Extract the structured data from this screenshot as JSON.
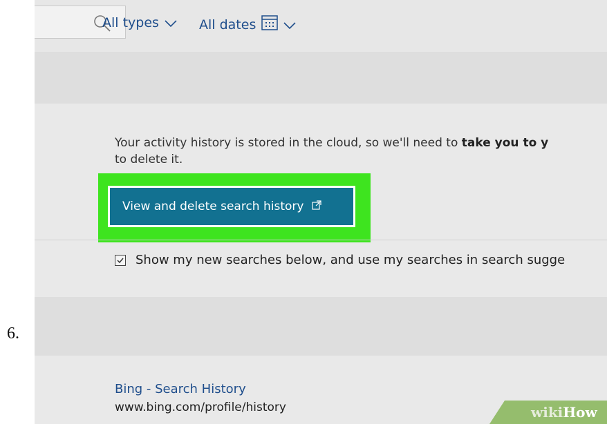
{
  "step_number": "6.",
  "toolbar": {
    "filter_types": "All types",
    "filter_dates": "All dates"
  },
  "notice": {
    "text_start": "Your activity history is stored in the cloud, so we'll need to ",
    "text_bold": "take you to y",
    "text_line2": "to delete it."
  },
  "primary_button": {
    "label": "View and delete search history"
  },
  "option": {
    "label": "Show my new searches below, and use my searches in search sugge"
  },
  "result": {
    "title": "Bing - Search History",
    "url": "www.bing.com/profile/history"
  },
  "watermark": {
    "part1": "wiki",
    "part2": "How"
  },
  "colors": {
    "accent_button": "#127191",
    "highlight": "#3ee41f",
    "link": "#1f4e8c"
  }
}
